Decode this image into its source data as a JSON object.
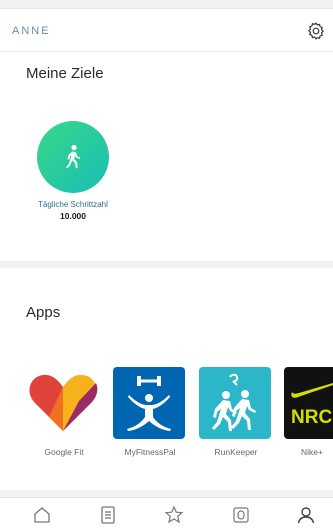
{
  "profile": {
    "name": "ANNE"
  },
  "goals": {
    "title": "Meine Ziele",
    "items": [
      {
        "label": "Tägliche Schrittzahl",
        "value": "10.000",
        "icon": "walking-person-icon"
      }
    ]
  },
  "apps": {
    "title": "Apps",
    "items": [
      {
        "label": "Google Fit",
        "icon": "google-fit-heart-icon"
      },
      {
        "label": "MyFitnessPal",
        "icon": "myfitnesspal-figure-icon",
        "mark": "+"
      },
      {
        "label": "RunKeeper",
        "icon": "runkeeper-runners-icon"
      },
      {
        "label": "Nike+",
        "icon": "nike-swoosh-icon",
        "mark": "NRC"
      }
    ]
  },
  "tabbar": {
    "items": [
      {
        "icon": "home-icon"
      },
      {
        "icon": "document-icon"
      },
      {
        "icon": "star-icon"
      },
      {
        "icon": "device-icon"
      },
      {
        "icon": "profile-icon"
      }
    ]
  },
  "colors": {
    "accent_teal": "#27c9a0",
    "myfitnesspal_blue": "#0066b2",
    "runkeeper_teal": "#2bb6c9",
    "nike_black": "#111111",
    "nike_yellow": "#cfe000"
  }
}
